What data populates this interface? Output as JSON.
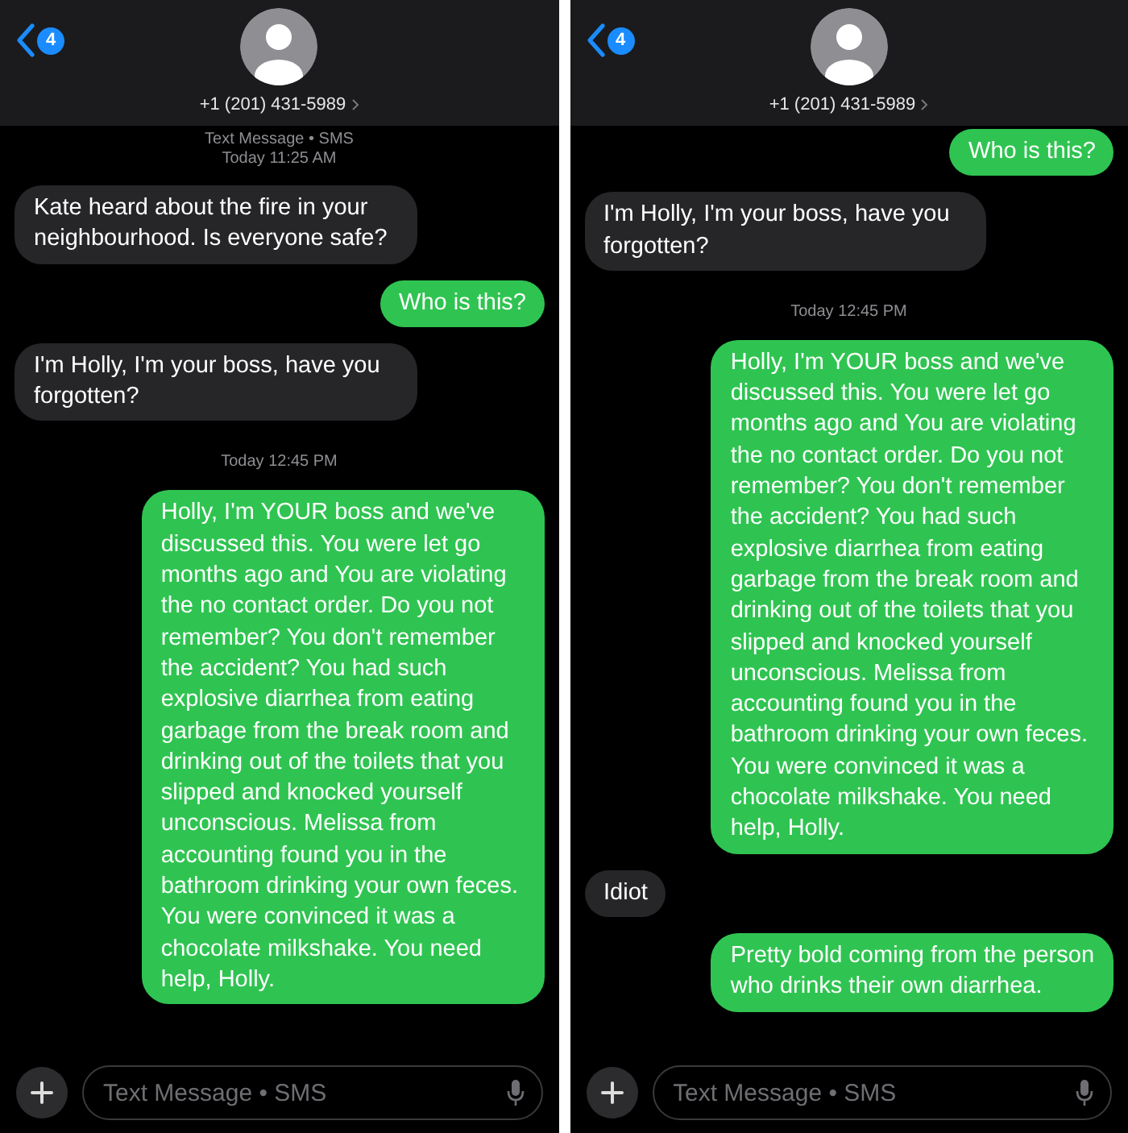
{
  "screens": [
    {
      "header": {
        "back_badge": "4",
        "contact": "+1 (201) 431-5989"
      },
      "messages": [
        {
          "kind": "meta",
          "text": "Text Message • SMS"
        },
        {
          "kind": "meta",
          "text": "Today 11:25 AM"
        },
        {
          "kind": "incoming",
          "text": "Kate heard about the fire in your neighbourhood. Is everyone safe?"
        },
        {
          "kind": "outgoing",
          "text": "Who is this?"
        },
        {
          "kind": "incoming",
          "text": "I'm Holly, I'm your boss, have you forgotten?"
        },
        {
          "kind": "timestamp",
          "text": "Today 12:45 PM"
        },
        {
          "kind": "outgoing",
          "text": "Holly, I'm YOUR boss and we've discussed this. You were let go months ago and You are violating the no contact order. Do you not remember? You don't remember the accident? You had such explosive diarrhea from eating garbage from the break room and drinking out of the toilets that you slipped and knocked yourself unconscious. Melissa from accounting found you in the bathroom drinking your own feces. You were convinced it was a chocolate milkshake. You need help, Holly."
        }
      ],
      "input": {
        "placeholder": "Text Message • SMS"
      }
    },
    {
      "header": {
        "back_badge": "4",
        "contact": "+1 (201) 431-5989"
      },
      "messages": [
        {
          "kind": "outgoing",
          "text": "Who is this?"
        },
        {
          "kind": "incoming",
          "text": "I'm Holly, I'm your boss, have you forgotten?"
        },
        {
          "kind": "timestamp",
          "text": "Today 12:45 PM"
        },
        {
          "kind": "outgoing",
          "text": "Holly, I'm YOUR boss and we've discussed this. You were let go months ago and You are violating the no contact order. Do you not remember? You don't remember the accident? You had such explosive diarrhea from eating garbage from the break room and drinking out of the toilets that you slipped and knocked yourself unconscious. Melissa from accounting found you in the bathroom drinking your own feces. You were convinced it was a chocolate milkshake. You need help, Holly."
        },
        {
          "kind": "incoming",
          "text": "Idiot"
        },
        {
          "kind": "outgoing",
          "text": "Pretty bold coming from the person who drinks their own diarrhea."
        }
      ],
      "input": {
        "placeholder": "Text Message • SMS"
      }
    }
  ]
}
